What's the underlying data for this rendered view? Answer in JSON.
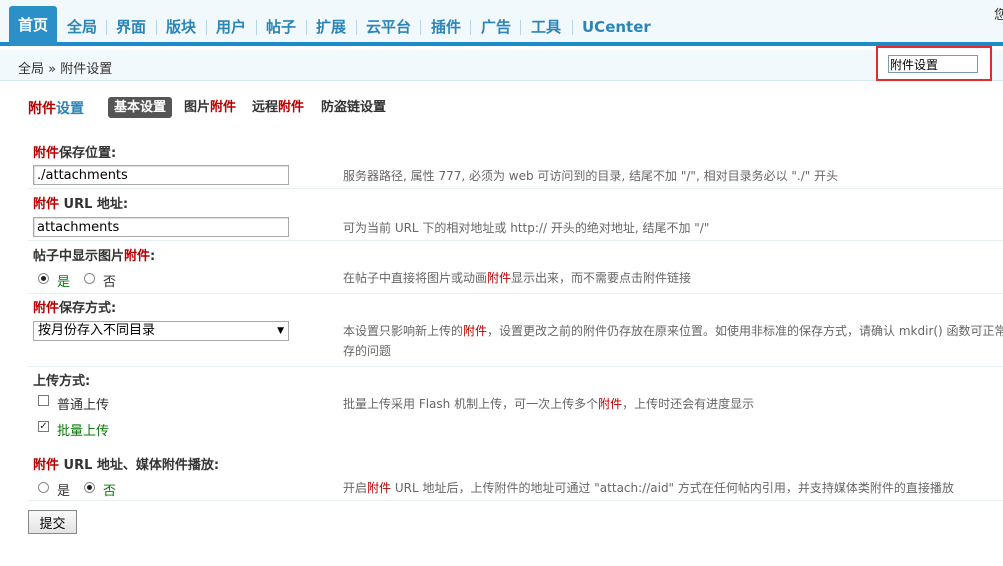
{
  "nav": {
    "tabs": [
      "首页",
      "全局",
      "界面",
      "版块",
      "用户",
      "帖子",
      "扩展",
      "云平台",
      "插件",
      "广告",
      "工具",
      "UCenter"
    ],
    "corner_text": "您"
  },
  "breadcrumb": "全局 » 附件设置",
  "search": {
    "value": "附件设置"
  },
  "page_title": {
    "part1": "附件",
    "part2": "设置"
  },
  "subtabs": {
    "basic": "基本设置",
    "image_pre": "图片",
    "image_hl": "附件",
    "remote_pre": "远程",
    "remote_hl": "附件",
    "hotlink": "防盗链设置"
  },
  "fields": {
    "save_location": {
      "label_hl": "附件",
      "label_rest": "保存位置:",
      "value": "./attachments",
      "tip": "服务器路径, 属性 777, 必须为 web 可访问到的目录, 结尾不加 \"/\", 相对目录务必以 \"./\" 开头"
    },
    "url": {
      "label_hl": "附件",
      "label_rest": " URL 地址:",
      "value": "attachments",
      "tip": "可为当前 URL 下的相对地址或 http:// 开头的绝对地址, 结尾不加 \"/\""
    },
    "show_images": {
      "label_rest": "帖子中显示图片",
      "label_hl": "附件",
      "label_end": ":",
      "yes": "是",
      "no": "否",
      "tip_pre": "在帖子中直接将图片或动画",
      "tip_hl": "附件",
      "tip_post": "显示出来，而不需要点击附件链接"
    },
    "save_method": {
      "label_hl": "附件",
      "label_rest": "保存方式:",
      "selected": "按月份存入不同目录",
      "tip_pre": "本设置只影响新上传的",
      "tip_hl": "附件",
      "tip_post": "，设置更改之前的附件仍存放在原来位置。如使用非标准的保存方式，请确认 mkdir() 函数可正常",
      "tip_line2": "存的问题"
    },
    "upload_method": {
      "label": "上传方式:",
      "opt1": "普通上传",
      "opt2": "批量上传",
      "tip_pre": "批量上传采用 Flash 机制上传，可一次上传多个",
      "tip_hl": "附件",
      "tip_post": "，上传时还会有进度显示"
    },
    "media_play": {
      "label_hl": "附件",
      "label_rest": " URL 地址、媒体附件播放:",
      "yes": "是",
      "no": "否",
      "tip_pre": "开启",
      "tip_hl": "附件",
      "tip_post": " URL 地址后，上传附件的地址可通过 \"attach://aid\" 方式在任何帖内引用，并支持媒体类附件的直接播放"
    }
  },
  "submit_label": "提交"
}
